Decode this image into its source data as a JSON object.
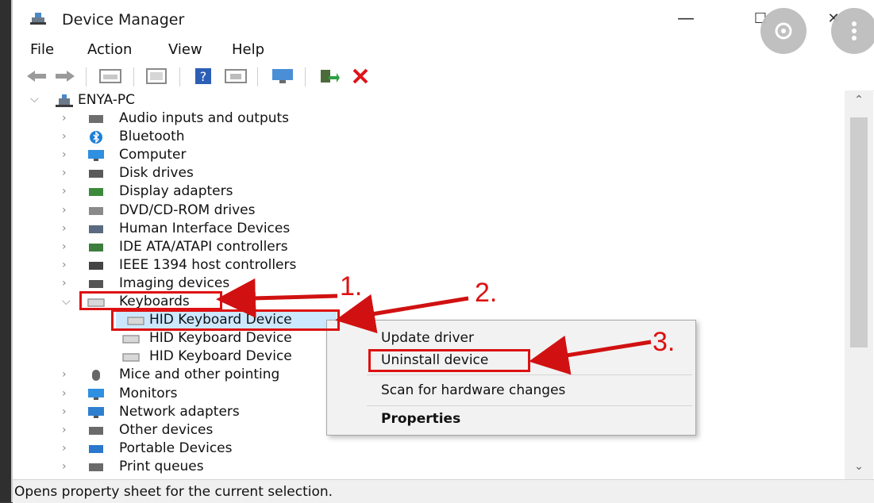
{
  "window": {
    "title": "Device Manager",
    "controls": {
      "minimize": "—",
      "maximize": "☐",
      "close": "✕"
    }
  },
  "menu": [
    "File",
    "Action",
    "View",
    "Help"
  ],
  "tree": {
    "root": "ENYA-PC",
    "items": [
      {
        "label": "Audio inputs and outputs",
        "icon": "speaker-icon"
      },
      {
        "label": "Bluetooth",
        "icon": "bluetooth-icon"
      },
      {
        "label": "Computer",
        "icon": "monitor-icon"
      },
      {
        "label": "Disk drives",
        "icon": "disk-drive-icon"
      },
      {
        "label": "Display adapters",
        "icon": "display-adapter-icon"
      },
      {
        "label": "DVD/CD-ROM drives",
        "icon": "dvd-drive-icon"
      },
      {
        "label": "Human Interface Devices",
        "icon": "hid-icon"
      },
      {
        "label": "IDE ATA/ATAPI controllers",
        "icon": "ide-controller-icon"
      },
      {
        "label": "IEEE 1394 host controllers",
        "icon": "ieee1394-icon"
      },
      {
        "label": "Imaging devices",
        "icon": "camera-icon"
      },
      {
        "label": "Keyboards",
        "icon": "keyboard-icon"
      },
      {
        "label": "HID Keyboard Device",
        "icon": "keyboard-icon"
      },
      {
        "label": "HID Keyboard Device",
        "icon": "keyboard-icon"
      },
      {
        "label": "HID Keyboard Device",
        "icon": "keyboard-icon"
      },
      {
        "label": "Mice and other pointing",
        "icon": "mouse-icon"
      },
      {
        "label": "Monitors",
        "icon": "monitor-icon"
      },
      {
        "label": "Network adapters",
        "icon": "network-icon"
      },
      {
        "label": "Other devices",
        "icon": "unknown-device-icon"
      },
      {
        "label": "Portable Devices",
        "icon": "portable-device-icon"
      },
      {
        "label": "Print queues",
        "icon": "printer-icon"
      }
    ]
  },
  "context_menu": {
    "update": "Update driver",
    "uninstall": "Uninstall device",
    "scan": "Scan for hardware changes",
    "properties": "Properties"
  },
  "annotations": {
    "step1": "1.",
    "step2": "2.",
    "step3": "3."
  },
  "status": "Opens property sheet for the current selection.",
  "colors": {
    "annotation_red": "#d11111",
    "selection": "#cce8ff"
  }
}
